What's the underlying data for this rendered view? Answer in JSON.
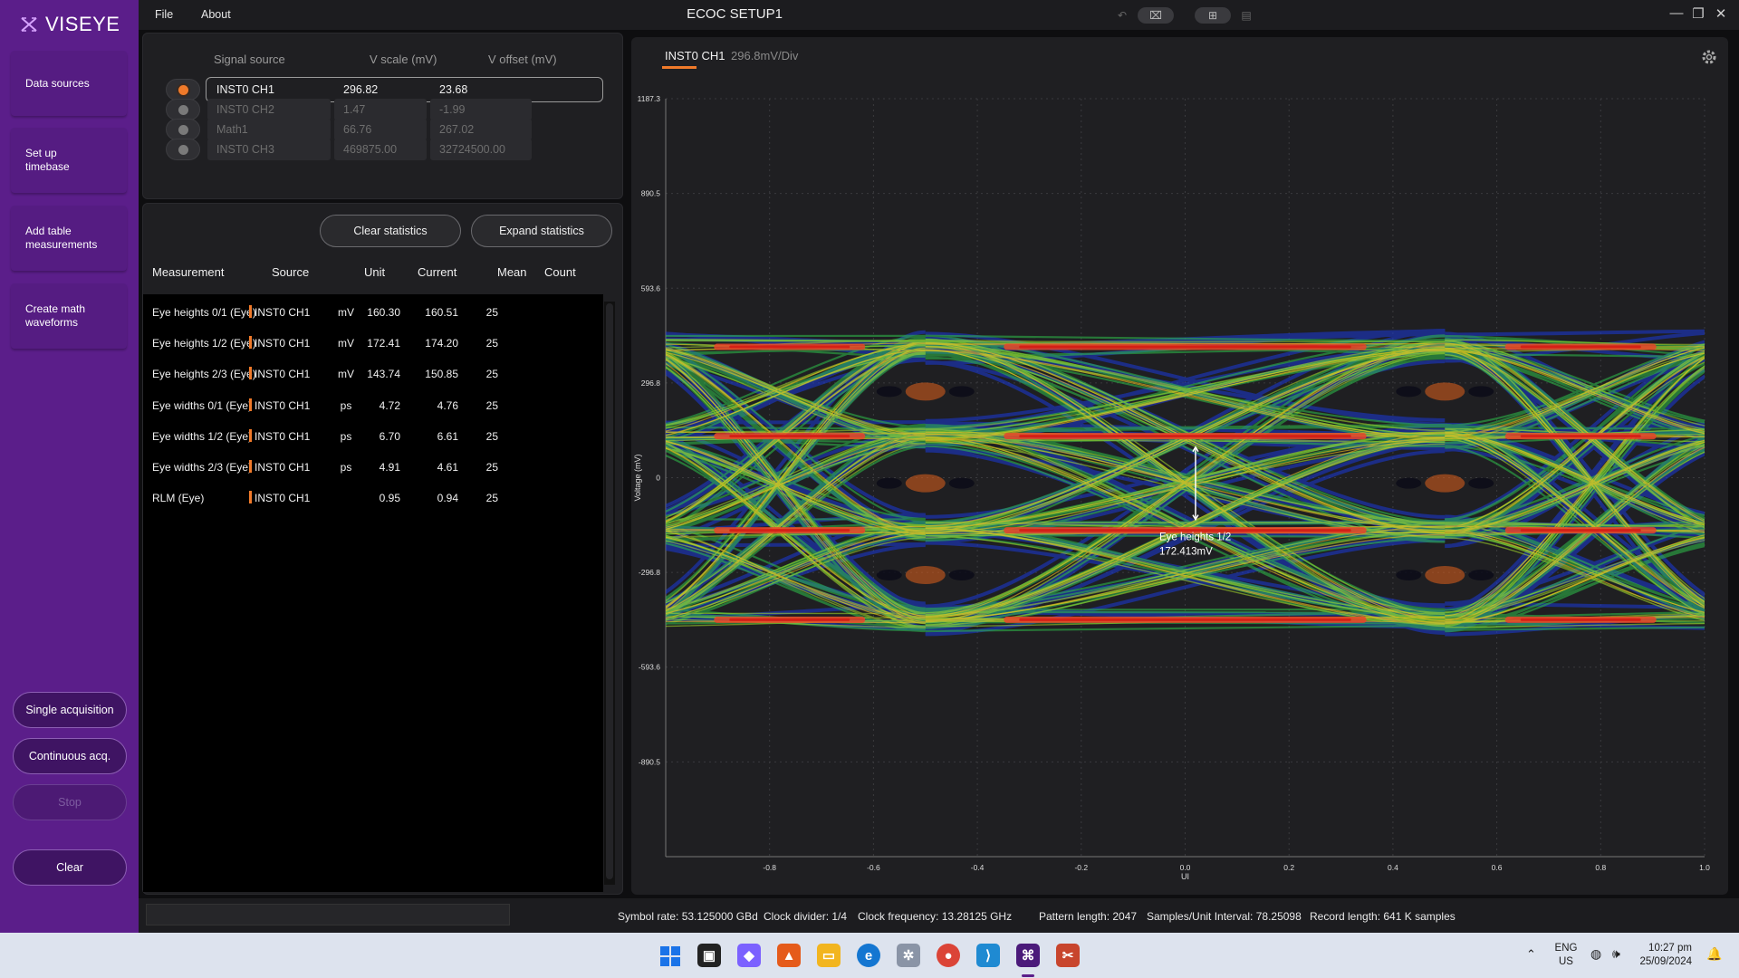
{
  "app": {
    "name": "VISEYE",
    "title": "ECOC SETUP1"
  },
  "menu": {
    "file": "File",
    "about": "About"
  },
  "sidebar": {
    "items": [
      {
        "label": "Data sources"
      },
      {
        "label": "Set up timebase"
      },
      {
        "label": "Add table measurements"
      },
      {
        "label": "Create math waveforms"
      }
    ],
    "buttons": {
      "single": "Single acquisition",
      "continuous": "Continuous acq.",
      "stop": "Stop",
      "clear": "Clear"
    }
  },
  "sources": {
    "headers": {
      "signal": "Signal source",
      "vscale": "V scale (mV)",
      "voffset": "V offset (mV)"
    },
    "rows": [
      {
        "name": "INST0 CH1",
        "vscale": "296.82",
        "voffset": "23.68",
        "selected": true
      },
      {
        "name": "INST0 CH2",
        "vscale": "1.47",
        "voffset": "-1.99",
        "selected": false
      },
      {
        "name": "Math1",
        "vscale": "66.76",
        "voffset": "267.02",
        "selected": false
      },
      {
        "name": "INST0 CH3",
        "vscale": "469875.00",
        "voffset": "32724500.00",
        "selected": false
      }
    ]
  },
  "stats": {
    "clear_label": "Clear statistics",
    "expand_label": "Expand statistics",
    "headers": {
      "measurement": "Measurement",
      "source": "Source",
      "unit": "Unit",
      "current": "Current",
      "mean": "Mean",
      "count": "Count"
    },
    "rows": [
      {
        "measurement": "Eye heights 0/1 (Eye)",
        "source": "INST0 CH1",
        "unit": "mV",
        "current": "160.30",
        "mean": "160.51",
        "count": "25"
      },
      {
        "measurement": "Eye heights 1/2 (Eye)",
        "source": "INST0 CH1",
        "unit": "mV",
        "current": "172.41",
        "mean": "174.20",
        "count": "25"
      },
      {
        "measurement": "Eye heights 2/3 (Eye)",
        "source": "INST0 CH1",
        "unit": "mV",
        "current": "143.74",
        "mean": "150.85",
        "count": "25"
      },
      {
        "measurement": "Eye widths 0/1 (Eye)",
        "source": "INST0 CH1",
        "unit": "ps",
        "current": "4.72",
        "mean": "4.76",
        "count": "25"
      },
      {
        "measurement": "Eye widths 1/2 (Eye)",
        "source": "INST0 CH1",
        "unit": "ps",
        "current": "6.70",
        "mean": "6.61",
        "count": "25"
      },
      {
        "measurement": "Eye widths 2/3 (Eye)",
        "source": "INST0 CH1",
        "unit": "ps",
        "current": "4.91",
        "mean": "4.61",
        "count": "25"
      },
      {
        "measurement": "RLM (Eye)",
        "source": "INST0 CH1",
        "unit": "",
        "current": "0.95",
        "mean": "0.94",
        "count": "25"
      }
    ]
  },
  "plot": {
    "tab_label": "INST0 CH1",
    "tab_sub": "296.8mV/Div",
    "xlabel": "UI",
    "ylabel": "Voltage (mV)",
    "annotation": {
      "label": "Eye heights 1/2",
      "value": "172.413mV"
    },
    "accent": "#f07a2a"
  },
  "chart_data": {
    "type": "heatmap",
    "title": "",
    "xlabel": "UI",
    "ylabel": "Voltage (mV)",
    "xlim": [
      -1.0,
      1.0
    ],
    "ylim": [
      -1187.3,
      1187.3
    ],
    "x_ticks": [
      "-0.8",
      "-0.6",
      "-0.4",
      "-0.2",
      "0.0",
      "0.2",
      "0.4",
      "0.6",
      "0.8",
      "1.0"
    ],
    "x_tick_values": [
      -0.8,
      -0.6,
      -0.4,
      -0.2,
      0.0,
      0.2,
      0.4,
      0.6,
      0.8,
      1.0
    ],
    "y_ticks": [
      "1187.3",
      "890.5",
      "593.6",
      "296.8",
      "0",
      "-296.8",
      "-593.6",
      "-890.5"
    ],
    "y_tick_values": [
      1187.3,
      890.5,
      593.6,
      296.8,
      0,
      -296.8,
      -593.6,
      -890.5
    ],
    "levels_mV": [
      -445,
      -165,
      130,
      410
    ],
    "crossing_ui": [
      -0.5,
      0.5
    ],
    "grid": true
  },
  "statusbar": {
    "symbol_rate": "Symbol rate: 53.125000 GBd",
    "clock_divider": "Clock divider: 1/4",
    "clock_freq": "Clock frequency: 13.28125 GHz",
    "pattern_length": "Pattern length: 2047",
    "samples_ui": "Samples/Unit Interval: 78.25098",
    "record_length": "Record length: 641 K samples"
  },
  "taskbar": {
    "lang1": "ENG",
    "lang2": "US",
    "time": "10:27 pm",
    "date": "25/09/2024"
  }
}
